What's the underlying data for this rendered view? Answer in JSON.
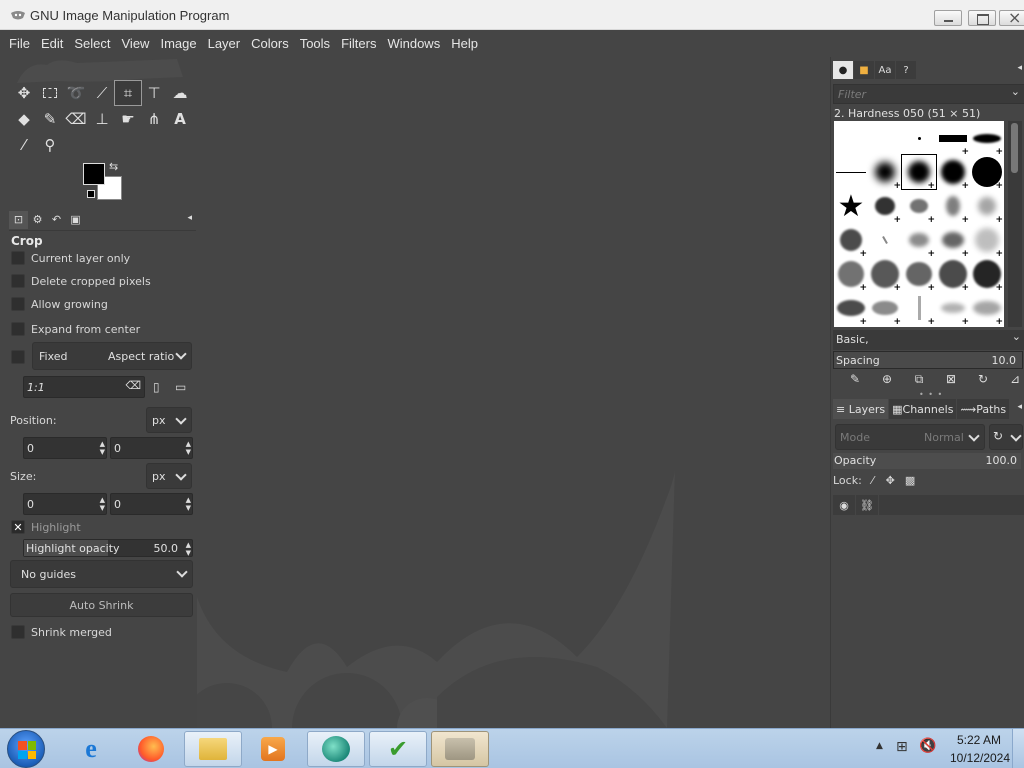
{
  "window": {
    "title": "GNU Image Manipulation Program"
  },
  "menu": [
    "File",
    "Edit",
    "Select",
    "View",
    "Image",
    "Layer",
    "Colors",
    "Tools",
    "Filters",
    "Windows",
    "Help"
  ],
  "tool_options": {
    "title": "Crop",
    "current_layer_only": "Current layer only",
    "delete_cropped_pixels": "Delete cropped pixels",
    "allow_growing": "Allow growing",
    "expand_from_center": "Expand from center",
    "fixed_label": "Fixed",
    "fixed_mode": "Aspect ratio",
    "ratio_value": "1:1",
    "position_label": "Position:",
    "position_unit": "px",
    "position_x": "0",
    "position_y": "0",
    "size_label": "Size:",
    "size_unit": "px",
    "size_w": "0",
    "size_h": "0",
    "highlight_label": "Highlight",
    "highlight_opacity_label": "Highlight opacity",
    "highlight_opacity_value": "50.0",
    "highlight_opacity_fraction": 0.5,
    "guides": "No guides",
    "auto_shrink": "Auto Shrink",
    "shrink_merged": "Shrink merged"
  },
  "brushes": {
    "filter_placeholder": "Filter",
    "selected_brush": "2. Hardness 050 (51 × 51)",
    "tag": "Basic,",
    "spacing_label": "Spacing",
    "spacing_value": "10.0"
  },
  "layers": {
    "tabs": [
      "Layers",
      "Channels",
      "Paths"
    ],
    "mode_label": "Mode",
    "mode_value": "Normal",
    "opacity_label": "Opacity",
    "opacity_value": "100.0",
    "lock_label": "Lock:"
  },
  "taskbar": {
    "time": "5:22 AM",
    "date": "10/12/2024"
  },
  "colors": {
    "foreground": "#000000",
    "background": "#ffffff",
    "ui_dark": "#454545"
  }
}
